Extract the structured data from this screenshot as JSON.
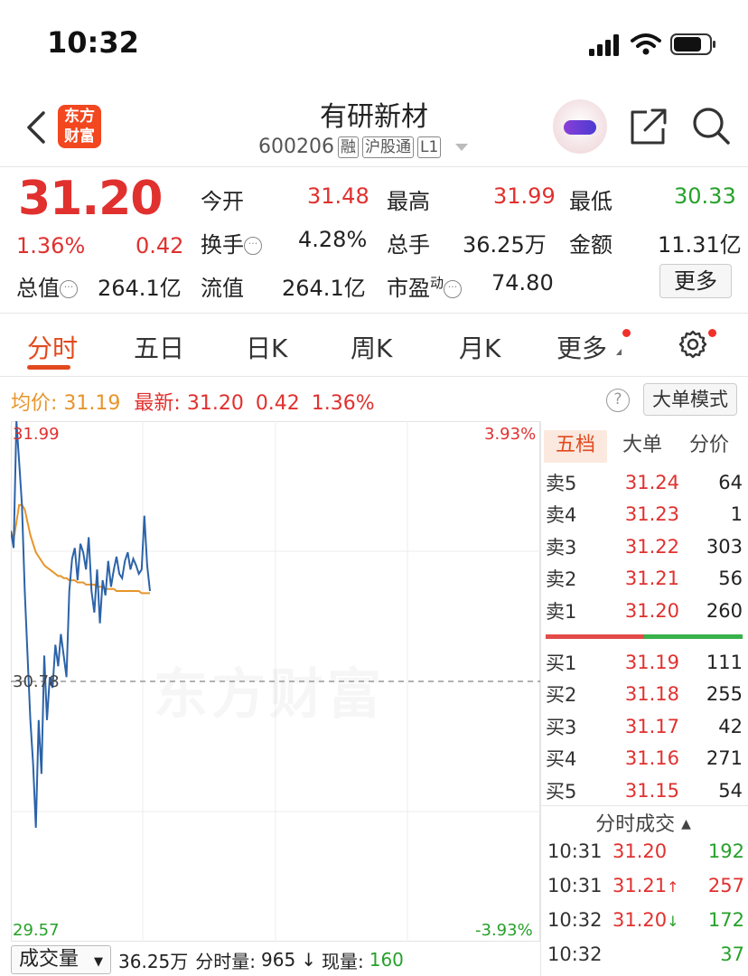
{
  "status_bar": {
    "time": "10:32"
  },
  "header": {
    "logo_line1": "东方",
    "logo_line2": "财富",
    "title": "有研新材",
    "code": "600206",
    "tags": [
      "融",
      "沪股通",
      "L1"
    ]
  },
  "quote": {
    "price": "31.20",
    "change_pct": "1.36%",
    "change": "0.42",
    "rows": [
      [
        {
          "label": "今开",
          "value": "31.48",
          "color": "red"
        },
        {
          "label": "最高",
          "value": "31.99",
          "color": "red"
        },
        {
          "label": "最低",
          "value": "30.33",
          "color": "green"
        }
      ],
      [
        {
          "label": "换手",
          "value": "4.28%",
          "color": "dark"
        },
        {
          "label": "总手",
          "value": "36.25万",
          "color": "dark"
        },
        {
          "label": "金额",
          "value": "11.31亿",
          "color": "dark"
        }
      ]
    ],
    "total_value_label": "总值",
    "total_value": "264.1亿",
    "float_value_label": "流值",
    "float_value": "264.1亿",
    "pe_label": "市盈",
    "pe_sup": "动",
    "pe_value": "74.80",
    "more_label": "更多"
  },
  "tabs": [
    "分时",
    "五日",
    "日K",
    "周K",
    "月K",
    "更多"
  ],
  "info_row": {
    "avg_label": "均价:",
    "avg_value": "31.19",
    "latest_label": "最新:",
    "latest_value": "31.20",
    "latest_change": "0.42",
    "latest_pct": "1.36%",
    "help": "?",
    "mode_button": "大单模式"
  },
  "chart_labels": {
    "top_price": "31.99",
    "mid_price": "30.78",
    "bottom_price": "29.57",
    "top_pct": "3.93%",
    "bottom_pct": "-3.93%",
    "watermark": "东方财富"
  },
  "chart_data": {
    "type": "line",
    "ylim": [
      29.57,
      31.99
    ],
    "y_right_range": [
      "-3.93%",
      "3.93%"
    ],
    "reference_price": 30.78,
    "grid": true,
    "series": [
      {
        "key": "price",
        "color": "#2c63a8",
        "values": [
          31.48,
          31.4,
          31.99,
          31.8,
          31.6,
          31.2,
          30.9,
          30.6,
          30.4,
          30.1,
          30.6,
          30.35,
          30.9,
          30.6,
          30.8,
          30.75,
          30.95,
          30.85,
          31.0,
          30.9,
          30.8,
          31.2,
          31.35,
          31.4,
          31.25,
          31.42,
          31.38,
          31.3,
          31.45,
          31.2,
          31.1,
          31.3,
          31.05,
          31.25,
          31.18,
          31.34,
          31.22,
          31.3,
          31.36,
          31.28,
          31.26,
          31.34,
          31.38,
          31.3,
          31.35,
          31.32,
          31.28,
          31.3,
          31.55,
          31.32,
          31.2
        ]
      },
      {
        "key": "avg",
        "color": "#e7952a",
        "values": [
          31.48,
          31.44,
          31.52,
          31.6,
          31.6,
          31.58,
          31.52,
          31.46,
          31.42,
          31.38,
          31.36,
          31.34,
          31.32,
          31.31,
          31.3,
          31.29,
          31.28,
          31.27,
          31.27,
          31.26,
          31.26,
          31.25,
          31.25,
          31.25,
          31.24,
          31.24,
          31.24,
          31.23,
          31.23,
          31.23,
          31.23,
          31.22,
          31.22,
          31.22,
          31.21,
          31.21,
          31.21,
          31.21,
          31.2,
          31.2,
          31.2,
          31.2,
          31.2,
          31.2,
          31.2,
          31.2,
          31.2,
          31.19,
          31.19,
          31.19,
          31.19
        ]
      }
    ]
  },
  "order_book": {
    "tabs": [
      "五档",
      "大单",
      "分价"
    ],
    "sells": [
      {
        "label": "卖5",
        "price": "31.24",
        "volume": "64"
      },
      {
        "label": "卖4",
        "price": "31.23",
        "volume": "1"
      },
      {
        "label": "卖3",
        "price": "31.22",
        "volume": "303"
      },
      {
        "label": "卖2",
        "price": "31.21",
        "volume": "56"
      },
      {
        "label": "卖1",
        "price": "31.20",
        "volume": "260"
      }
    ],
    "buys": [
      {
        "label": "买1",
        "price": "31.19",
        "volume": "111"
      },
      {
        "label": "买2",
        "price": "31.18",
        "volume": "255"
      },
      {
        "label": "买3",
        "price": "31.17",
        "volume": "42"
      },
      {
        "label": "买4",
        "price": "31.16",
        "volume": "271"
      },
      {
        "label": "买5",
        "price": "31.15",
        "volume": "54"
      }
    ],
    "buy_sell_ratio": 0.5
  },
  "trades": {
    "title": "分时成交",
    "rows": [
      {
        "time": "10:31",
        "price": "31.20",
        "arrow": "",
        "volume": "192",
        "vol_color": "green"
      },
      {
        "time": "10:31",
        "price": "31.21",
        "arrow": "↑",
        "volume": "257",
        "vol_color": "red"
      },
      {
        "time": "10:32",
        "price": "31.20",
        "arrow": "↓",
        "volume": "172",
        "vol_color": "green"
      },
      {
        "time": "10:32",
        "price": "",
        "arrow": "",
        "volume": "37",
        "vol_color": "green"
      }
    ]
  },
  "bottom_bar": {
    "volume_button": "成交量",
    "total_volume": "36.25万",
    "minute_volume_label": "分时量:",
    "minute_volume": "965",
    "arrow": "↓",
    "current_label": "现量:",
    "current_volume": "160"
  },
  "colors": {
    "up": "#e0312f",
    "down": "#27a12b",
    "accent": "#e24a1e",
    "avg_line": "#e7952a",
    "price_line": "#2c63a8"
  }
}
